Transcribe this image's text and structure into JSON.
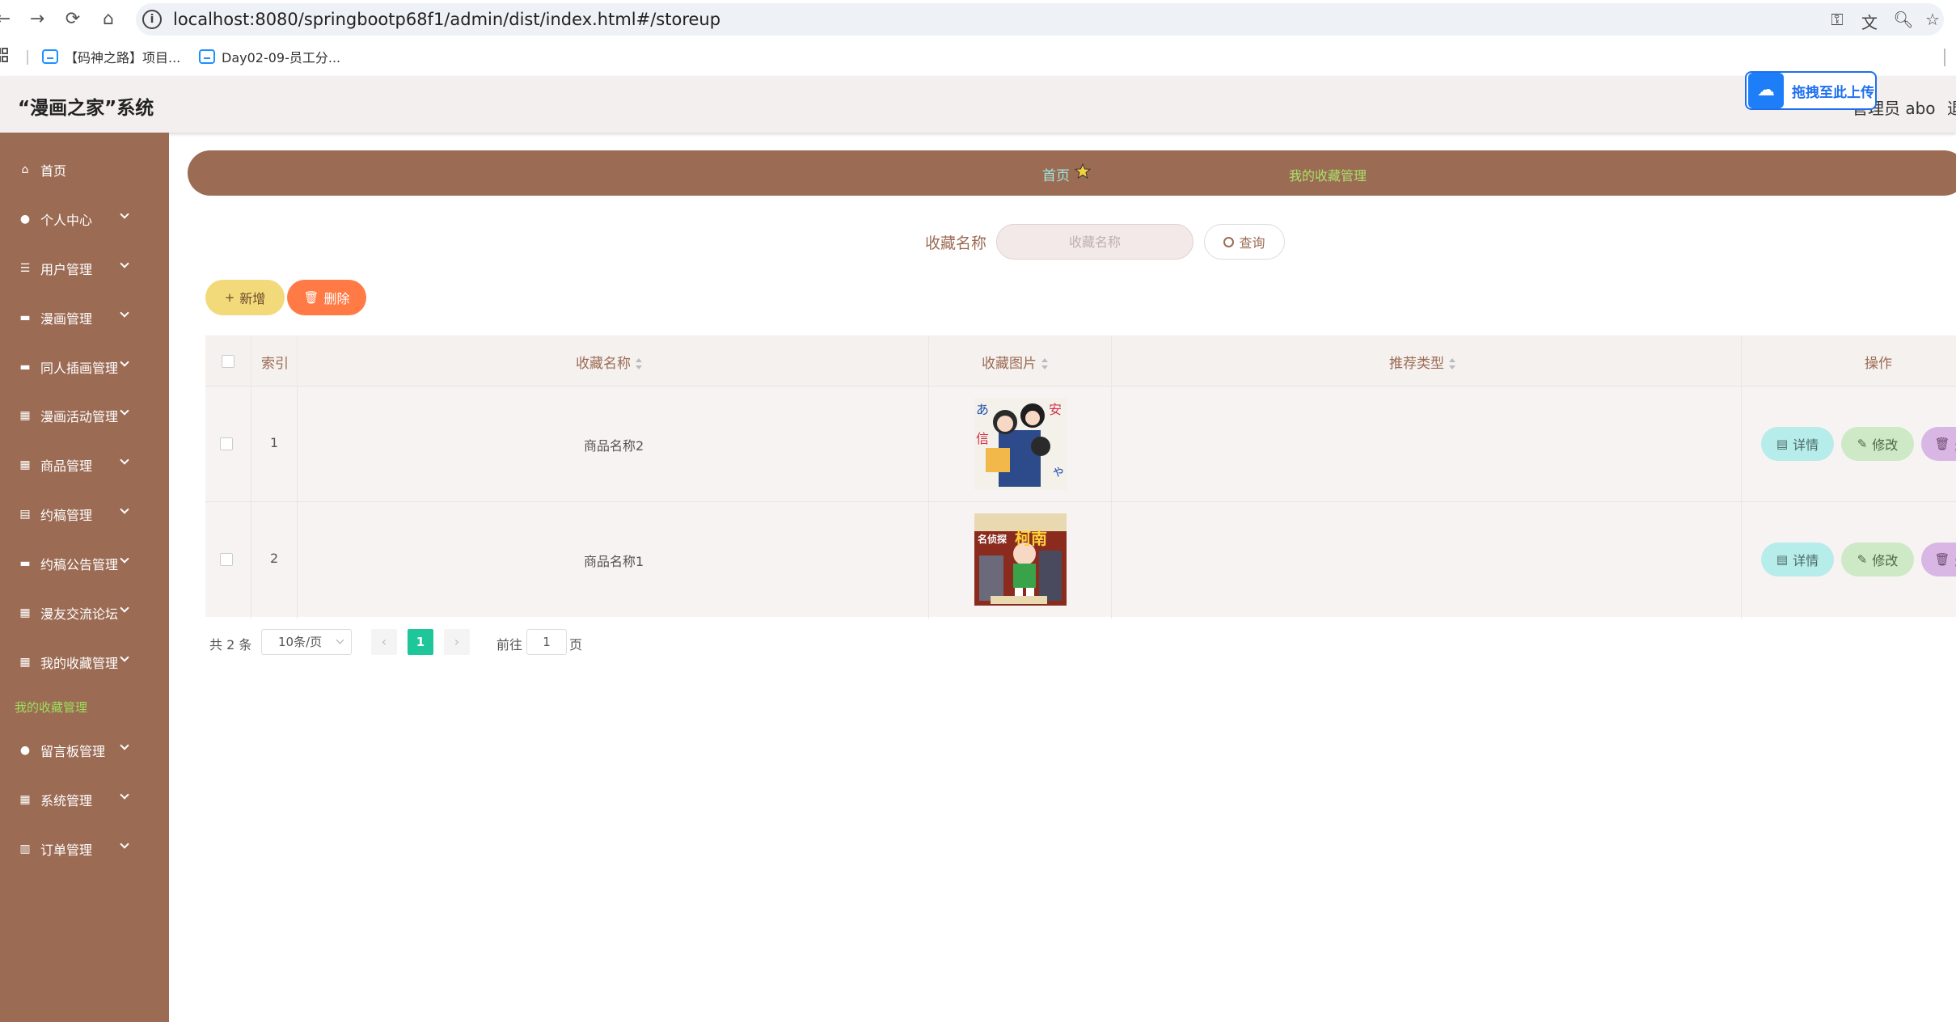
{
  "browser": {
    "url": "localhost:8080/springbootp68f1/admin/dist/index.html#/storeup",
    "bookmarks": [
      "【码神之路】项目...",
      "Day02-09-员工分..."
    ]
  },
  "header": {
    "title": "“漫画之家”系统",
    "user": "管理员 abo",
    "exit": "退",
    "upload_widget": "拖拽至此上传"
  },
  "sidebar": {
    "items": [
      {
        "label": "首页",
        "icon": "home-icon"
      },
      {
        "label": "个人中心",
        "icon": "user-icon"
      },
      {
        "label": "用户管理",
        "icon": "list-icon"
      },
      {
        "label": "漫画管理",
        "icon": "monitor-icon"
      },
      {
        "label": "同人插画管理",
        "icon": "monitor-icon"
      },
      {
        "label": "漫画活动管理",
        "icon": "grid-icon"
      },
      {
        "label": "商品管理",
        "icon": "grid-icon"
      },
      {
        "label": "约稿管理",
        "icon": "doc-icon"
      },
      {
        "label": "约稿公告管理",
        "icon": "monitor-icon"
      },
      {
        "label": "漫友交流论坛",
        "icon": "grid-icon"
      },
      {
        "label": "我的收藏管理",
        "icon": "grid-icon"
      },
      {
        "label": "留言板管理",
        "icon": "user-icon"
      },
      {
        "label": "系统管理",
        "icon": "grid-icon"
      },
      {
        "label": "订单管理",
        "icon": "chart-icon"
      }
    ],
    "active_submenu": "我的收藏管理"
  },
  "breadcrumb": {
    "home": "首页",
    "current": "我的收藏管理"
  },
  "search": {
    "label": "收藏名称",
    "placeholder": "收藏名称",
    "button": "查询"
  },
  "actions": {
    "add": "新增",
    "delete": "删除"
  },
  "table": {
    "columns": [
      "索引",
      "收藏名称",
      "收藏图片",
      "推荐类型",
      "操作"
    ],
    "rows": [
      {
        "index": "1",
        "name": "商品名称2",
        "type": ""
      },
      {
        "index": "2",
        "name": "商品名称1",
        "type": ""
      }
    ],
    "ops": {
      "detail": "详情",
      "edit": "修改",
      "delete": "删除"
    }
  },
  "pagination": {
    "total": "共 2 条",
    "page_size": "10条/页",
    "current": "1",
    "goto_label": "前往",
    "goto_value": "1",
    "page_suffix": "页"
  },
  "colors": {
    "brand": "#9c6b54",
    "accent_green": "#1ec69a"
  }
}
